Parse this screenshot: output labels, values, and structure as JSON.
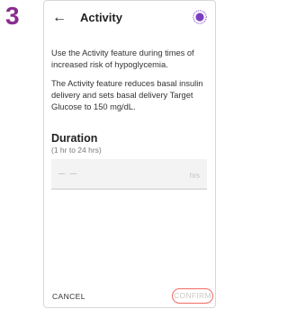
{
  "step_number": "3",
  "header": {
    "back_icon": "arrow-left-icon",
    "title": "Activity",
    "status_icon": "activity-status-icon"
  },
  "body": {
    "paragraph1": "Use the Activity feature during times of increased risk of hypoglycemia.",
    "paragraph2": "The Activity feature reduces basal insulin delivery and sets basal delivery Target Glucose to 150 mg/dL."
  },
  "duration": {
    "title": "Duration",
    "range": "(1 hr to 24 hrs)",
    "value": "– –",
    "unit": "hrs"
  },
  "footer": {
    "cancel_label": "CANCEL",
    "confirm_label": "CONFIRM"
  },
  "colors": {
    "step_number": "#8a2c8f",
    "confirm_highlight": "#f16a63",
    "status_icon": "#7a3fbf"
  }
}
